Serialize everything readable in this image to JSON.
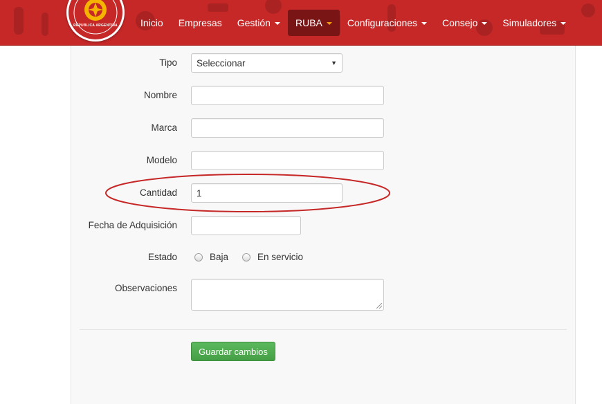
{
  "header": {
    "logo_text": "REPUBLICA ARGENTINA",
    "brand_color": "#c62828",
    "nav": [
      {
        "label": "Inicio",
        "dropdown": false
      },
      {
        "label": "Empresas",
        "dropdown": false
      },
      {
        "label": "Gestión",
        "dropdown": true
      },
      {
        "label": "RUBA",
        "dropdown": true,
        "active": true
      },
      {
        "label": "Configuraciones",
        "dropdown": true
      },
      {
        "label": "Consejo",
        "dropdown": true
      },
      {
        "label": "Simuladores",
        "dropdown": true
      }
    ]
  },
  "form": {
    "tipo": {
      "label": "Tipo",
      "value": "Seleccionar"
    },
    "nombre": {
      "label": "Nombre",
      "value": ""
    },
    "marca": {
      "label": "Marca",
      "value": ""
    },
    "modelo": {
      "label": "Modelo",
      "value": ""
    },
    "cantidad": {
      "label": "Cantidad",
      "value": "1"
    },
    "fecha": {
      "label": "Fecha de Adquisición",
      "value": ""
    },
    "estado": {
      "label": "Estado",
      "options": [
        "Baja",
        "En servicio"
      ]
    },
    "observaciones": {
      "label": "Observaciones",
      "value": ""
    },
    "save_label": "Guardar cambios"
  },
  "annotation": {
    "color": "#c62828"
  }
}
